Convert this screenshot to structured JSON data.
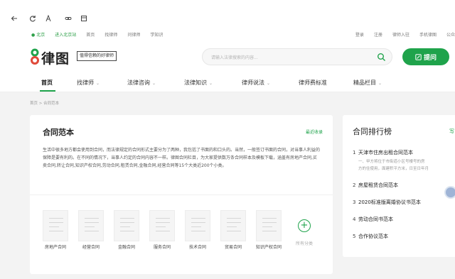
{
  "topbar": {
    "location": "北京",
    "join": "进入北京站",
    "links_left": [
      "首页",
      "找律师",
      "问律师",
      "学知识"
    ],
    "links_right": [
      "登录",
      "注册",
      "律师入驻",
      "手机律图",
      "公众"
    ]
  },
  "header": {
    "logo_text": "律图",
    "slogan": "值得信赖的好律师",
    "search_placeholder": "请输入法律搜索的内容...",
    "ask_label": "提问"
  },
  "nav": {
    "items": [
      {
        "label": "首页",
        "dropdown": false,
        "active": true
      },
      {
        "label": "找律师",
        "dropdown": true
      },
      {
        "label": "法律咨询",
        "dropdown": true
      },
      {
        "label": "法律知识",
        "dropdown": true
      },
      {
        "label": "律师说法",
        "dropdown": true
      },
      {
        "label": "律师费标准",
        "dropdown": false
      },
      {
        "label": "精品栏目",
        "dropdown": true
      }
    ]
  },
  "breadcrumb": "首页 > 合同范本",
  "main": {
    "title": "合同范本",
    "more": "最近收录",
    "desc": "生活中很多地方都会使用到合同，而法律规定的合同形式主要分为了两种，我包括了书面的和口头的。当然，一般签订书面的合同，对当事人利益的保障是要有利的。在不同的情况下，当事人约定的合同内容不一样。律图合同栏目，为大家提供数万条合同样本及模板下载，涵盖有房地产合同,买卖合同,转让合同,知识产权合同,劳动合同,租赁合同,金融合同,经营合同等15个大类近200个小类。",
    "categories": [
      "房地产合同",
      "经营合同",
      "金融合同",
      "服务合同",
      "技术合同",
      "贸易合同",
      "知识产权合同"
    ],
    "all_label": "所有分类"
  },
  "ranking": {
    "title": "合同排行榜",
    "more": "写",
    "items": [
      {
        "num": "1",
        "label": "天津市住房出租合同范本",
        "sub": [
          "一、甲方将位于市街道小区号楼号的房",
          "方的住使用，面建积平方米，日至日年月"
        ]
      },
      {
        "num": "2",
        "label": "房屋租赁合同范本"
      },
      {
        "num": "3",
        "label": "2020标准版离婚协议书范本"
      },
      {
        "num": "4",
        "label": "劳动合同书范本"
      },
      {
        "num": "5",
        "label": "合作协议范本"
      }
    ]
  },
  "colors": {
    "brand": "#1fa34b",
    "bg": "#f3f3f3"
  }
}
